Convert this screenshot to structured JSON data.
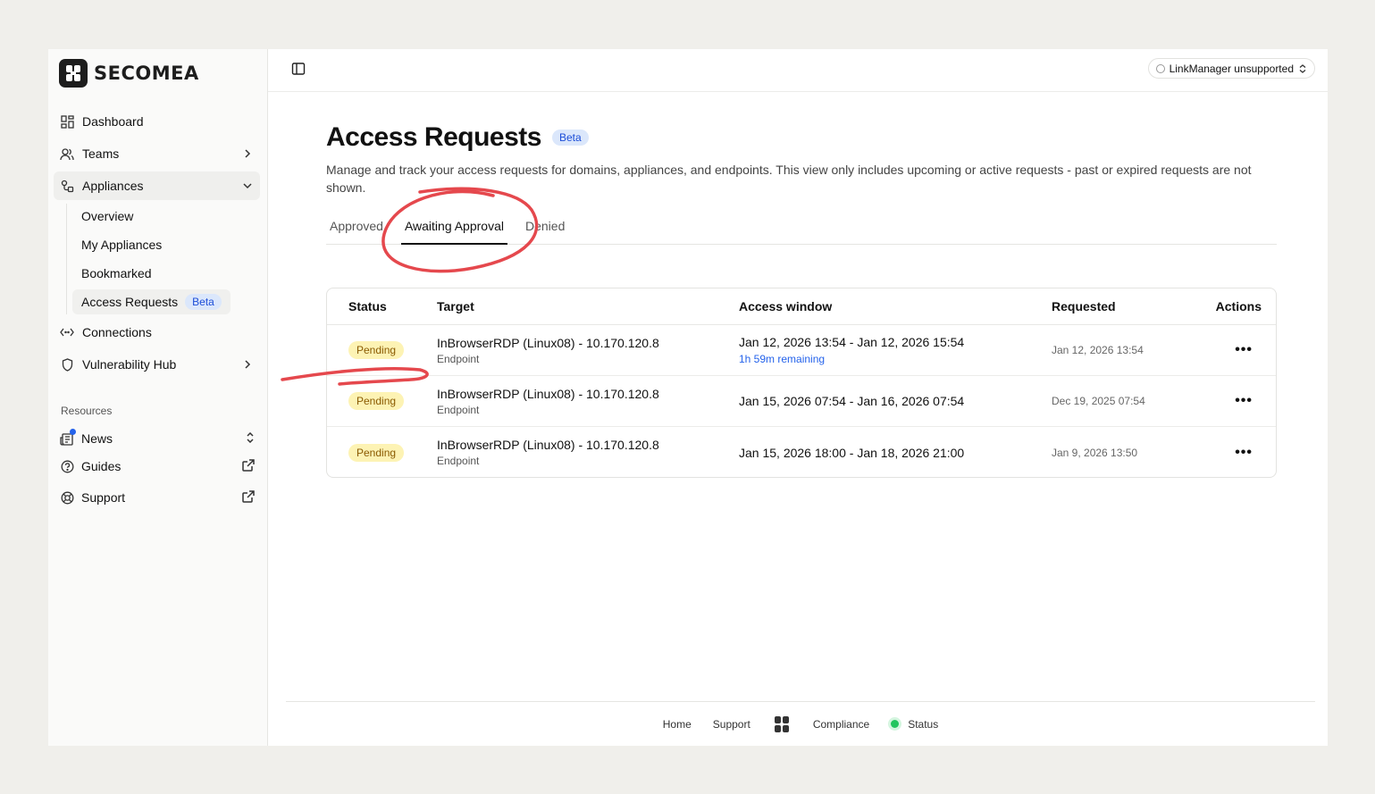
{
  "brand": {
    "name": "SECOMEA"
  },
  "sidebar": {
    "items": [
      {
        "label": "Dashboard",
        "icon": "dashboard-icon"
      },
      {
        "label": "Teams",
        "icon": "users-icon"
      },
      {
        "label": "Appliances",
        "icon": "appliances-icon"
      },
      {
        "label": "Connections",
        "icon": "code-icon"
      },
      {
        "label": "Vulnerability Hub",
        "icon": "shield-icon"
      }
    ],
    "appliances_sub": [
      {
        "label": "Overview"
      },
      {
        "label": "My Appliances"
      },
      {
        "label": "Bookmarked"
      },
      {
        "label": "Access Requests",
        "badge": "Beta"
      }
    ],
    "resources_label": "Resources",
    "resources": [
      {
        "label": "News",
        "icon": "newspaper-icon"
      },
      {
        "label": "Guides",
        "icon": "help-circle-icon"
      },
      {
        "label": "Support",
        "icon": "lifebuoy-icon"
      }
    ]
  },
  "topbar": {
    "linkmanager": "LinkManager unsupported"
  },
  "page": {
    "title": "Access Requests",
    "badge": "Beta",
    "description": "Manage and track your access requests for domains, appliances, and endpoints. This view only includes upcoming or active requests - past or expired requests are not shown.",
    "tabs": [
      {
        "label": "Approved"
      },
      {
        "label": "Awaiting Approval",
        "active": true
      },
      {
        "label": "Denied"
      }
    ]
  },
  "table": {
    "headers": {
      "status": "Status",
      "target": "Target",
      "window": "Access window",
      "requested": "Requested",
      "actions": "Actions"
    },
    "rows": [
      {
        "status": "Pending",
        "target": "InBrowserRDP (Linux08) - 10.170.120.8",
        "type": "Endpoint",
        "window": "Jan 12, 2026 13:54 - Jan 12, 2026 15:54",
        "remaining": "1h 59m remaining",
        "requested": "Jan 12, 2026 13:54"
      },
      {
        "status": "Pending",
        "target": "InBrowserRDP (Linux08) - 10.170.120.8",
        "type": "Endpoint",
        "window": "Jan 15, 2026 07:54 - Jan 16, 2026 07:54",
        "requested": "Dec 19, 2025 07:54"
      },
      {
        "status": "Pending",
        "target": "InBrowserRDP (Linux08) - 10.170.120.8",
        "type": "Endpoint",
        "window": "Jan 15, 2026 18:00 - Jan 18, 2026 21:00",
        "requested": "Jan 9, 2026 13:50"
      }
    ]
  },
  "footer": {
    "home": "Home",
    "support": "Support",
    "compliance": "Compliance",
    "status": "Status"
  },
  "colors": {
    "accent": "#2563eb",
    "pending_bg": "#fdf3b4",
    "annotation": "#e5484d",
    "status_ok": "#22c55e"
  }
}
